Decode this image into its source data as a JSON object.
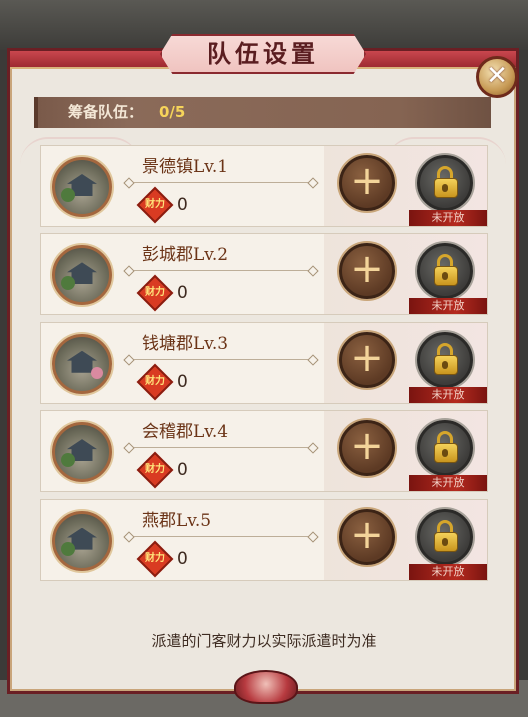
{
  "title": "队伍设置",
  "close_icon": "close-icon",
  "team": {
    "label": "筹备队伍：",
    "count": "0/5"
  },
  "wealth_icon_text": "财力",
  "rows": [
    {
      "name": "景德镇Lv.1",
      "wealth": "0",
      "lock_label": "未开放"
    },
    {
      "name": "彭城郡Lv.2",
      "wealth": "0",
      "lock_label": "未开放"
    },
    {
      "name": "钱塘郡Lv.3",
      "wealth": "0",
      "lock_label": "未开放"
    },
    {
      "name": "会稽郡Lv.4",
      "wealth": "0",
      "lock_label": "未开放"
    },
    {
      "name": "燕郡Lv.5",
      "wealth": "0",
      "lock_label": "未开放"
    }
  ],
  "footer_note": "派遣的门客财力以实际派遣时为准",
  "colors": {
    "frame_red": "#9e2a31",
    "gold": "#f6d45a",
    "panel": "#ece7df"
  }
}
